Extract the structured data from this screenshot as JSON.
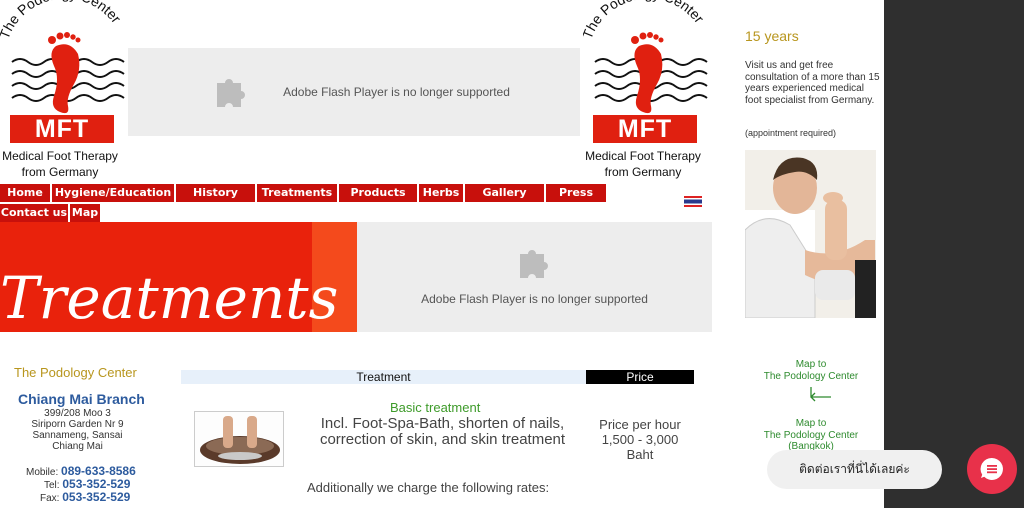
{
  "logo": {
    "arc_text": "The Podology Center",
    "badge": "MFT",
    "caption_line1": "Medical Foot Therapy",
    "caption_line2": "from Germany"
  },
  "flash_message": "Adobe Flash Player is no longer supported",
  "nav": {
    "row1": [
      "Home",
      "Hygiene/Education",
      "History",
      "Treatments",
      "Products",
      "Herbs",
      "Gallery",
      "Press"
    ],
    "row2": [
      "Contact us",
      "Map"
    ]
  },
  "hero": {
    "title": "Treatments"
  },
  "sidebar": {
    "years": "15 years",
    "visit_text": "Visit us and get free consultation of a more than 15 years experienced medical foot specialist from Germany.",
    "appointment": "(appointment required)",
    "map1_line1": "Map to",
    "map1_line2": "The Podology Center",
    "map2_line1": "Map to",
    "map2_line2": "The Podology Center",
    "map2_line3": "(Bangkok)"
  },
  "branch": {
    "center_name": "The Podology Center",
    "name": "Chiang Mai Branch",
    "address_line1": "399/208 Moo 3",
    "address_line2": "Siriporn Garden Nr 9",
    "address_line3": "Sannameng, Sansai",
    "address_line4": "Chiang Mai",
    "mobile_label": "Mobile:",
    "mobile": "089-633-8586",
    "tel_label": "Tel:",
    "tel": "053-352-529",
    "fax_label": "Fax:",
    "fax": "053-352-529"
  },
  "table": {
    "treatment_header": "Treatment",
    "price_header": "Price",
    "basic_title": "Basic treatment",
    "basic_desc": "Incl. Foot-Spa-Bath, shorten of nails, correction of skin, and skin treatment",
    "price_line1": "Price per hour",
    "price_line2": "1,500 - 3,000",
    "price_line3": "Baht",
    "additional": "Additionally we charge the following rates:"
  },
  "chat": {
    "bubble": "ติดต่อเราที่นี่ได้เลยค่ะ"
  },
  "colors": {
    "nav_red": "#c8100c",
    "hero_red": "#e9220c",
    "gold": "#b8961e",
    "link_blue": "#2d5b9e",
    "green": "#3e9b2a",
    "chat_pink": "#e8314a"
  }
}
